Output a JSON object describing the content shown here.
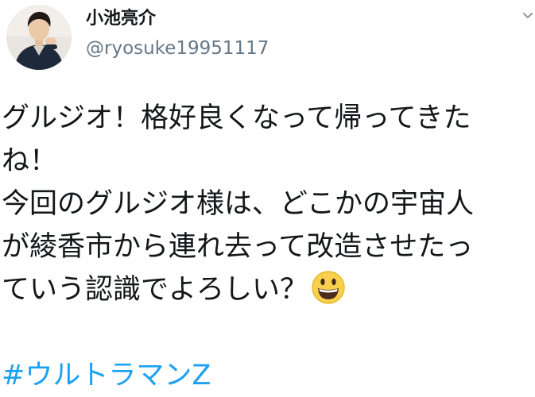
{
  "author": {
    "display_name": "小池亮介",
    "handle": "@ryosuke19951117"
  },
  "tweet": {
    "lines": [
      "グルジオ！格好良くなって帰ってきた",
      "ね！",
      "今回のグルジオ様は、どこかの宇宙人",
      "が綾香市から連れ去って改造させたっ",
      "ていう認識でよろしい？"
    ],
    "emoji": "grinning-face",
    "hashtag": "#ウルトラマンZ"
  },
  "colors": {
    "text": "#14171a",
    "secondary": "#657786",
    "link": "#1da1f2"
  },
  "icons": {
    "menu_caret": "chevron-down-icon",
    "emoji": "grinning-face-emoji-icon"
  }
}
